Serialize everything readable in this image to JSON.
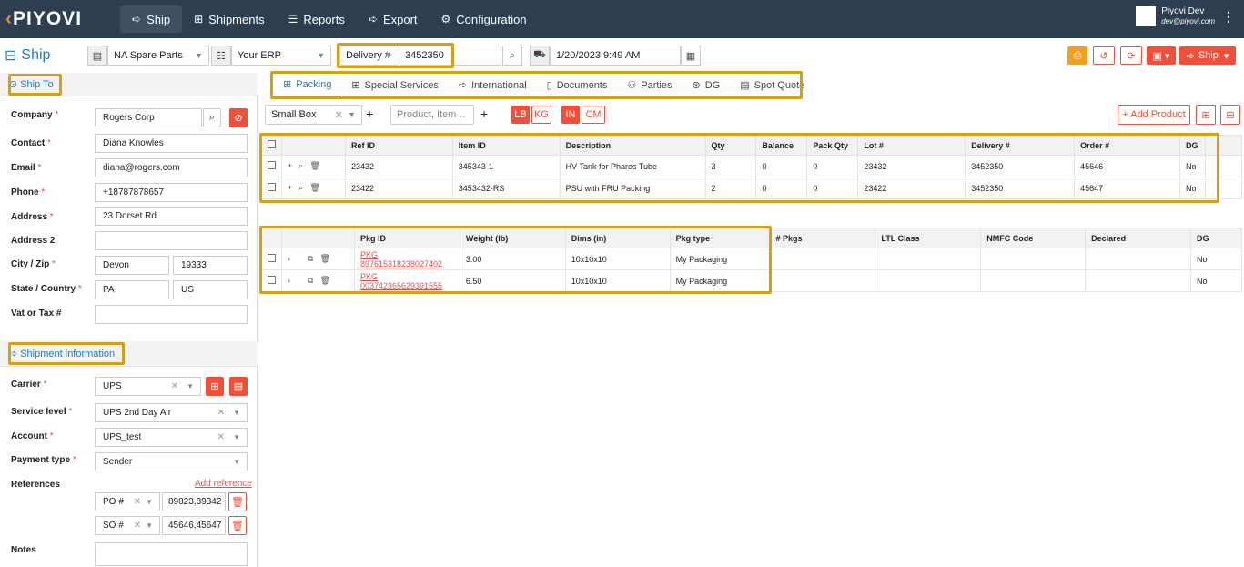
{
  "app": {
    "logo": "PIYOVI",
    "page_title": "Ship"
  },
  "nav": [
    {
      "label": "Ship",
      "icon": "ship-icon"
    },
    {
      "label": "Shipments",
      "icon": "boxes-icon"
    },
    {
      "label": "Reports",
      "icon": "chart-icon"
    },
    {
      "label": "Export",
      "icon": "export-icon"
    },
    {
      "label": "Configuration",
      "icon": "gear-icon"
    }
  ],
  "user": {
    "name": "Piyovi Dev",
    "email": "dev@piyovi.com"
  },
  "toolbar": {
    "location": "NA Spare Parts",
    "erp": "Your ERP",
    "doc_type": "Delivery #",
    "doc_number": "3452350",
    "ship_date": "1/20/2023 9:49 AM",
    "ship_button": "Ship"
  },
  "ship_to": {
    "header": "Ship To",
    "fields": {
      "company": {
        "label": "Company",
        "value": "Rogers Corp"
      },
      "contact": {
        "label": "Contact",
        "value": "Diana Knowles"
      },
      "email": {
        "label": "Email",
        "value": "diana@rogers.com"
      },
      "phone": {
        "label": "Phone",
        "value": "+18787878657"
      },
      "address": {
        "label": "Address",
        "value": "23 Dorset Rd"
      },
      "address2": {
        "label": "Address 2",
        "value": ""
      },
      "city_zip": {
        "label": "City / Zip",
        "city": "Devon",
        "zip": "19333"
      },
      "state_country": {
        "label": "State / Country",
        "state": "PA",
        "country": "US"
      },
      "vat": {
        "label": "Vat or Tax #",
        "value": ""
      }
    }
  },
  "shipment_info": {
    "header": "Shipment information",
    "carrier": {
      "label": "Carrier",
      "value": "UPS"
    },
    "service": {
      "label": "Service level",
      "value": "UPS 2nd Day Air"
    },
    "account": {
      "label": "Account",
      "value": "UPS_test"
    },
    "payment": {
      "label": "Payment type",
      "value": "Sender"
    },
    "references": {
      "label": "References",
      "add_label": "Add reference",
      "items": [
        {
          "type": "PO #",
          "value": "89823,89342"
        },
        {
          "type": "SO #",
          "value": "45646,45647"
        }
      ]
    },
    "notes": {
      "label": "Notes",
      "value": ""
    }
  },
  "tabs": [
    {
      "label": "Packing",
      "icon": "packing-icon"
    },
    {
      "label": "Special Services",
      "icon": "services-icon"
    },
    {
      "label": "International",
      "icon": "international-icon"
    },
    {
      "label": "Documents",
      "icon": "documents-icon"
    },
    {
      "label": "Parties",
      "icon": "parties-icon"
    },
    {
      "label": "DG",
      "icon": "dg-icon"
    },
    {
      "label": "Spot Quote",
      "icon": "quote-icon"
    }
  ],
  "packing": {
    "box_type": "Small Box",
    "product_placeholder": "Product, Item ..",
    "weight_units": [
      "LB",
      "KG"
    ],
    "dim_units": [
      "IN",
      "CM"
    ],
    "add_product": "+ Add Product"
  },
  "items_table": {
    "headers": [
      "Ref ID",
      "Item ID",
      "Description",
      "Qty",
      "Balance",
      "Pack Qty",
      "Lot #",
      "Delivery #",
      "Order #",
      "DG"
    ],
    "rows": [
      [
        "23432",
        "345343-1",
        "HV Tank for Pharos Tube",
        "3",
        "0",
        "0",
        "23432",
        "3452350",
        "45646",
        "No"
      ],
      [
        "23422",
        "3453432-RS",
        "PSU with FRU Packing",
        "2",
        "0",
        "0",
        "23422",
        "3452350",
        "45647",
        "No"
      ]
    ]
  },
  "pkg_table": {
    "headers": [
      "Pkg ID",
      "Weight (lb)",
      "Dims (in)",
      "Pkg type",
      "# Pkgs",
      "LTL Class",
      "NMFC Code",
      "Declared",
      "DG"
    ],
    "rows": [
      [
        "PKG 897615318238027402",
        "3.00",
        "10x10x10",
        "My Packaging",
        "",
        "",
        "",
        "",
        "No"
      ],
      [
        "PKG 003742365629391555",
        "6.50",
        "10x10x10",
        "My Packaging",
        "",
        "",
        "",
        "",
        "No"
      ]
    ]
  },
  "colors": {
    "topbar": "#2d3e50",
    "accent": "#2a7ab8",
    "danger": "#f0503a",
    "highlight": "#d4a017"
  }
}
